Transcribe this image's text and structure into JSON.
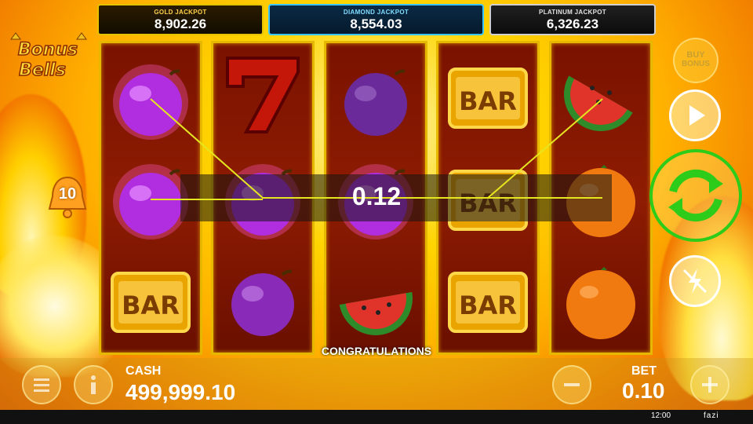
{
  "jackpots": {
    "gold": {
      "label": "GOLD JACKPOT",
      "value": "8,902.26"
    },
    "diamond": {
      "label": "DIAMOND JACKPOT",
      "value": "8,554.03"
    },
    "platinum": {
      "label": "PLATINUM JACKPOT",
      "value": "6,326.23"
    }
  },
  "logo": {
    "line1": "Bonus",
    "line2": "Bells"
  },
  "lines_badge": "10",
  "reels": [
    [
      "plum",
      "plum",
      "bar"
    ],
    [
      "seven",
      "plum",
      "plum"
    ],
    [
      "plum",
      "plum",
      "watermelon"
    ],
    [
      "bar",
      "bar",
      "bar"
    ],
    [
      "watermelon",
      "orange",
      "orange"
    ]
  ],
  "bar_text": "BAR",
  "win_amount": "0.12",
  "message": "CONGRATULATIONS",
  "cash": {
    "label": "CASH",
    "value": "499,999.10"
  },
  "bet": {
    "label": "BET",
    "value": "0.10"
  },
  "buy_bonus": {
    "line1": "BUY",
    "line2": "BONUS"
  },
  "status_bar": {
    "time": "12:00",
    "brand": "fazi"
  },
  "colors": {
    "spin_green": "#2ecc1a",
    "jackpot_gold": "#e6c200",
    "jackpot_diamond": "#39c4ff",
    "reel_frame": "#e6b800"
  }
}
